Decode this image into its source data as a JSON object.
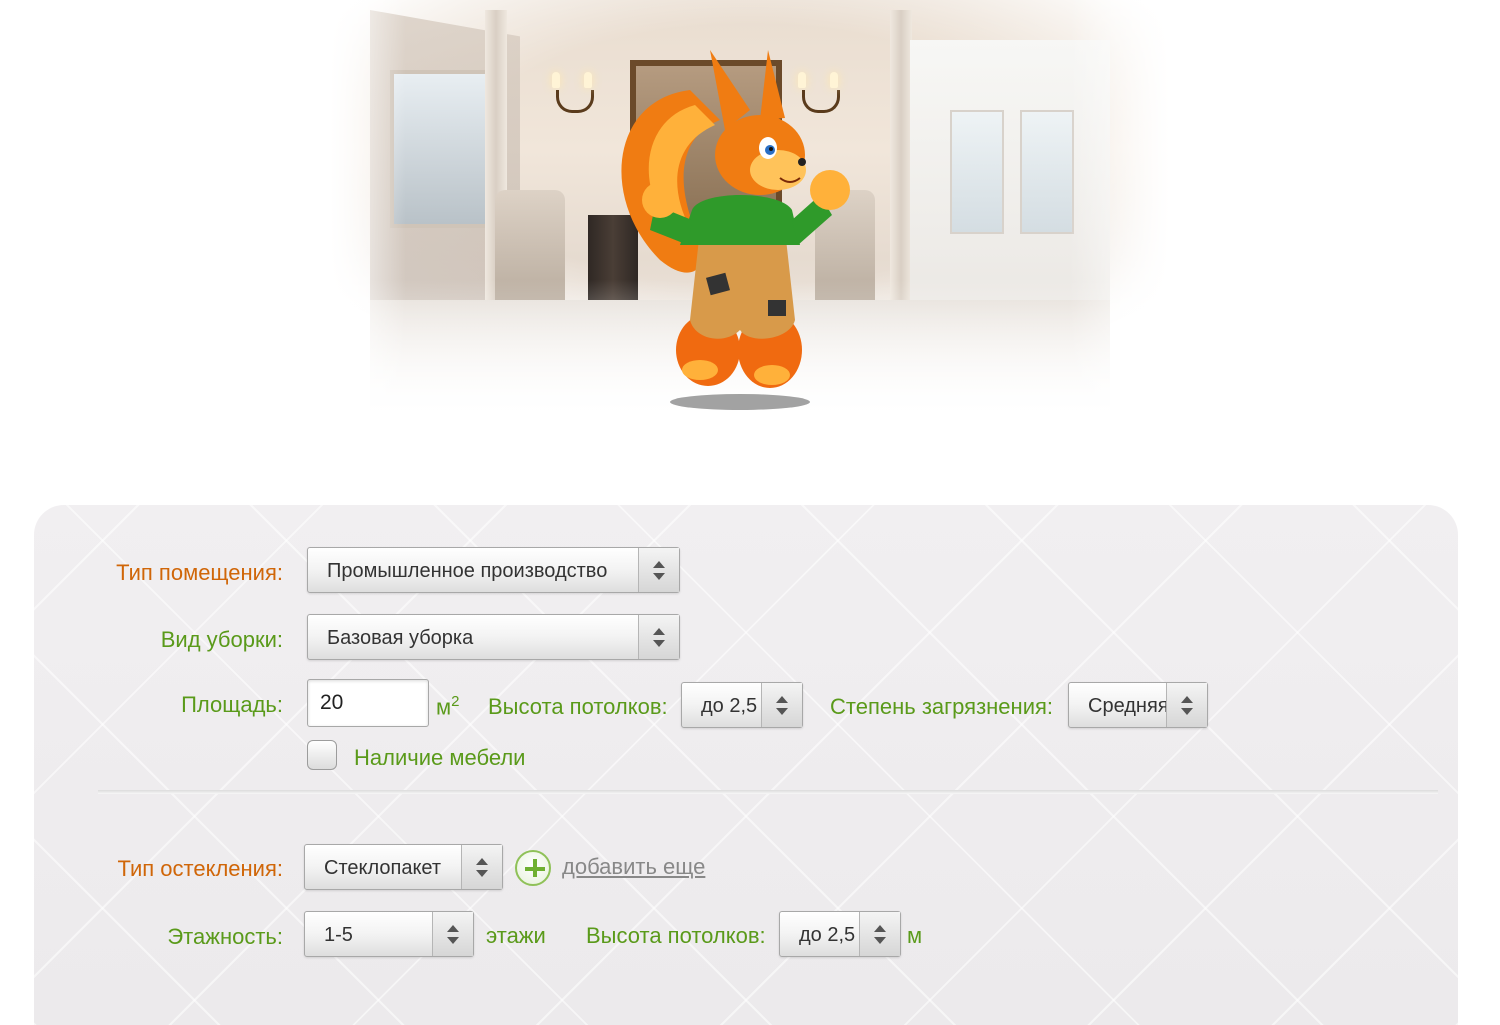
{
  "form": {
    "room_type": {
      "label": "Тип помещения:",
      "value": "Промышленное производство"
    },
    "cleaning_type": {
      "label": "Вид уборки:",
      "value": "Базовая уборка"
    },
    "area": {
      "label": "Площадь:",
      "value": "20",
      "unit": "м",
      "unit_sup": "2"
    },
    "ceiling_height": {
      "label": "Высота потолков:",
      "value": "до 2,5"
    },
    "dirt_level": {
      "label": "Степень загрязнения:",
      "value": "Средняя"
    },
    "furniture": {
      "label": "Наличие мебели",
      "checked": false
    },
    "glazing_type": {
      "label": "Тип остекления:",
      "value": "Стеклопакет",
      "add_more": "добавить еще"
    },
    "floors": {
      "label": "Этажность:",
      "value": "1-5",
      "suffix": "этажи"
    },
    "glazing_ceiling_height": {
      "label": "Высота потолков:",
      "value": "до 2,5",
      "unit": "м"
    }
  },
  "colors": {
    "label_orange": "#d06608",
    "label_green": "#5a9a1a",
    "panel_bg": "#efedef"
  },
  "icons": {
    "mascot": "squirrel-mascot-illustration",
    "add": "plus-circle-icon",
    "select_arrow": "updown-chevron-icon"
  }
}
